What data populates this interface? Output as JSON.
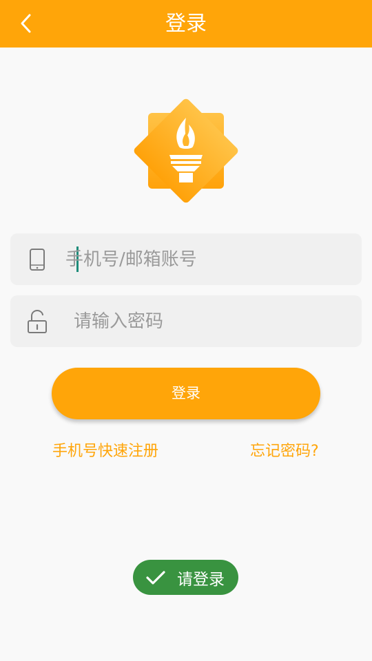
{
  "app_bar": {
    "title": "登录",
    "back_icon": "chevron-left-icon"
  },
  "logo": {
    "icon": "torch-badge-icon"
  },
  "phone_field": {
    "icon": "mobile-phone-icon",
    "placeholder": "手机号/邮箱账号",
    "value": ""
  },
  "password_field": {
    "icon": "unlocked-padlock-icon",
    "placeholder": "请输入密码",
    "value": ""
  },
  "login_button": {
    "label": "登录"
  },
  "links": {
    "register": "手机号快速注册",
    "forgot": "忘记密码?"
  },
  "toast": {
    "icon": "checkmark-icon",
    "message": "请登录"
  },
  "colors": {
    "primary": "#ffa509",
    "toast_bg": "#399340",
    "field_bg": "#f0f0f0",
    "page_bg": "#f9f9f9"
  }
}
